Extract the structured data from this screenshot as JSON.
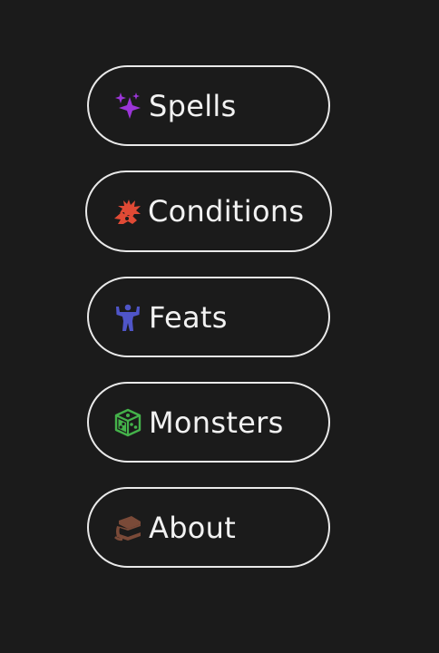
{
  "menu": {
    "items": [
      {
        "label": "Spells",
        "icon": "sparkles-icon",
        "icon_color": "#9b35d8"
      },
      {
        "label": "Conditions",
        "icon": "burst-creature-icon",
        "icon_color": "#e04a35"
      },
      {
        "label": "Feats",
        "icon": "strongman-icon",
        "icon_color": "#4f55c8"
      },
      {
        "label": "Monsters",
        "icon": "die-icon",
        "icon_color": "#44b24a"
      },
      {
        "label": "About",
        "icon": "book-icon",
        "icon_color": "#7a4a38"
      }
    ]
  },
  "colors": {
    "background": "#1b1b1b",
    "border": "#e9e9e9",
    "text": "#f2f2f2"
  }
}
